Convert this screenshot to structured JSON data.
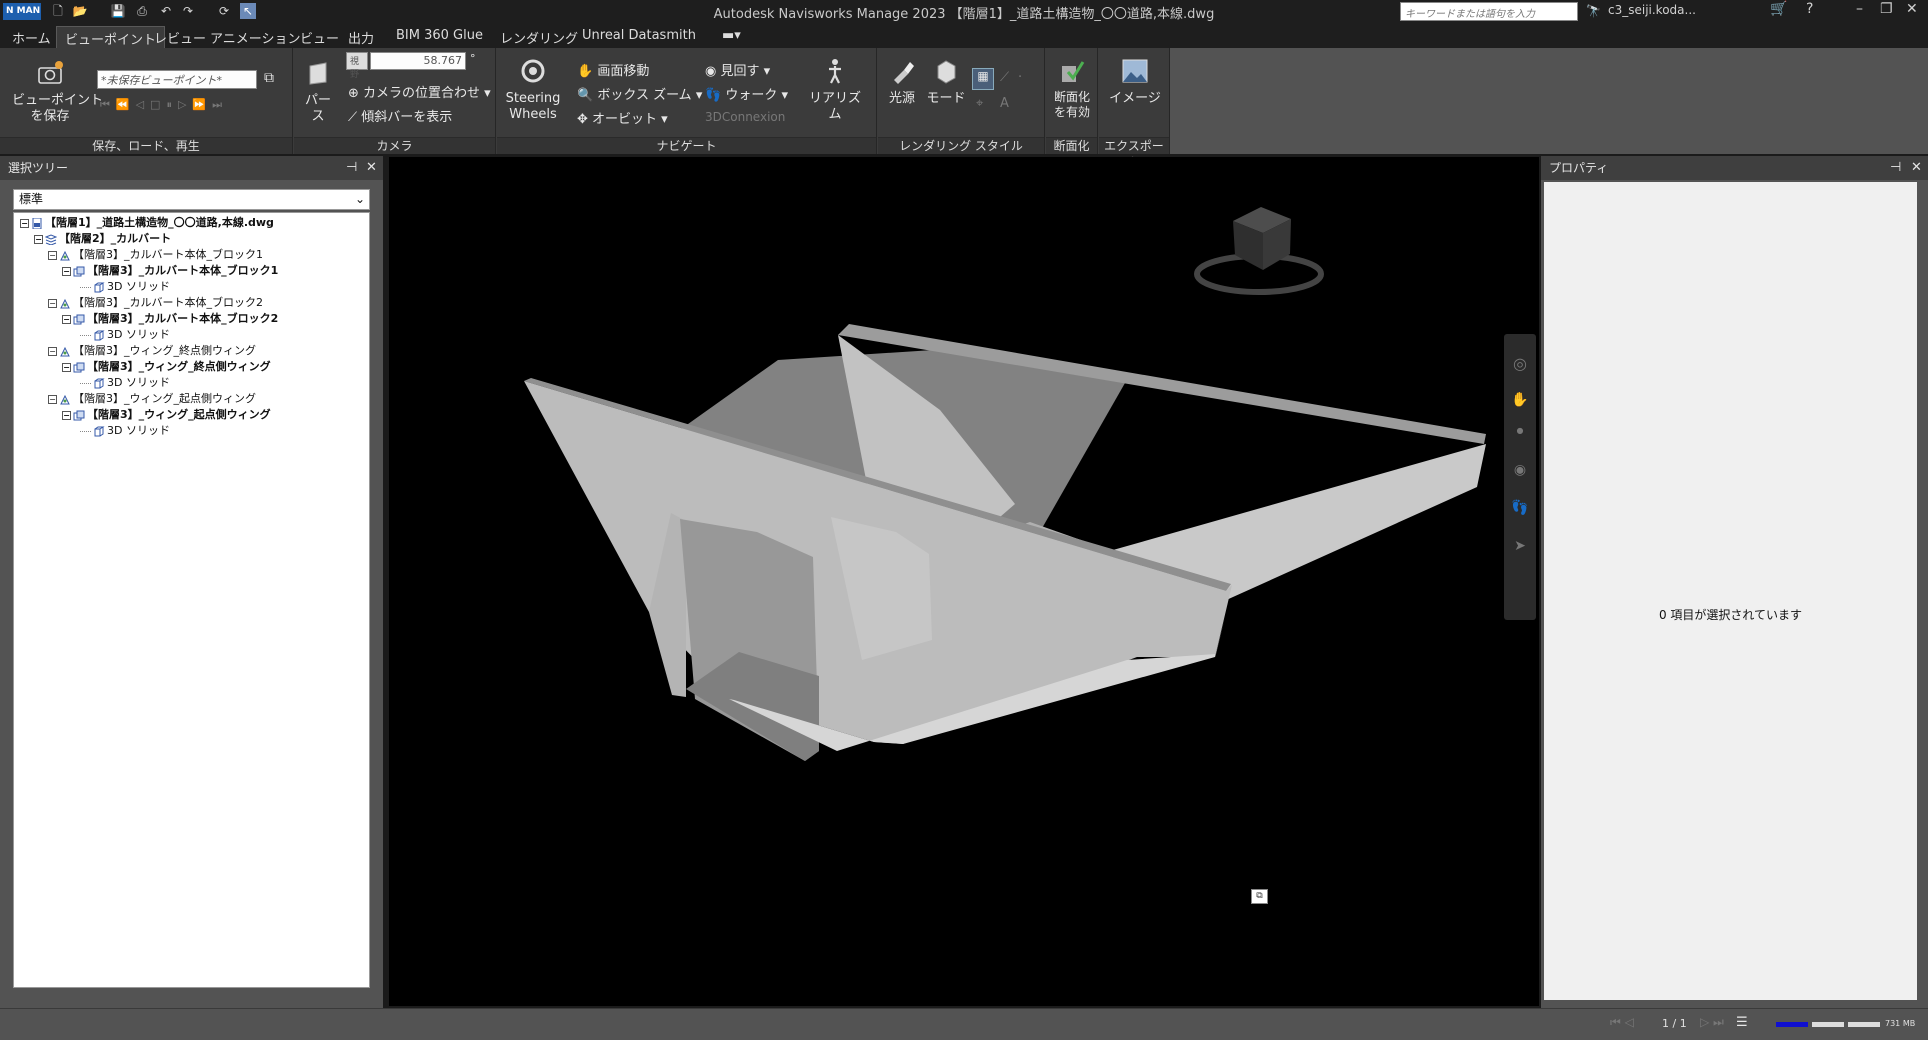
{
  "app": {
    "logo": "N MAN",
    "title": "Autodesk Navisworks Manage 2023 【階層1】_道路土構造物_〇〇道路,本線.dwg"
  },
  "titlebar": {
    "search_placeholder": "キーワードまたは語句を入力",
    "user": "c3_seiji.koda..."
  },
  "tabs": [
    "ホーム",
    "ビューポイント",
    "レビュー",
    "アニメーション",
    "ビュー",
    "出力",
    "BIM 360 Glue",
    "レンダリング",
    "Unreal Datasmith"
  ],
  "active_tab": "ビューポイント",
  "ribbon": {
    "save": {
      "button": "ビューポイント\nを保存",
      "viewpoint_placeholder": "*未保存ビューポイント*",
      "panel_title": "保存、ロード、再生"
    },
    "camera": {
      "perspective": "パース",
      "fov_label": "視野",
      "fov_value": "58.767",
      "fov_unit": "°",
      "align": "カメラの位置合わせ",
      "tilt": "傾斜バーを表示",
      "panel_title": "カメラ"
    },
    "navigate": {
      "steering": "Steering\nWheels",
      "pan": "画面移動",
      "box_zoom": "ボックス ズーム",
      "orbit": "オービット",
      "look": "見回す",
      "walk": "ウォーク",
      "connexion": "3DConnexion",
      "realism": "リアリズム",
      "panel_title": "ナビゲート"
    },
    "render_style": {
      "light": "光源",
      "mode": "モード",
      "panel_title": "レンダリング スタイル"
    },
    "sectioning": {
      "enable": "断面化\nを有効",
      "panel_title": "断面化"
    },
    "export": {
      "image": "イメージ",
      "panel_title": "エクスポート"
    }
  },
  "selection_tree": {
    "title": "選択ツリー",
    "mode": "標準",
    "nodes": [
      {
        "label": "【階層1】_道路土構造物_〇〇道路,本線.dwg",
        "bold": true,
        "level": 0,
        "expand": "−",
        "icon": "file"
      },
      {
        "label": "【階層2】_カルバート",
        "bold": true,
        "level": 1,
        "expand": "−",
        "icon": "layer"
      },
      {
        "label": "【階層3】_カルバート本体_ブロック1",
        "bold": false,
        "level": 2,
        "expand": "−",
        "icon": "block"
      },
      {
        "label": "【階層3】_カルバート本体_ブロック1",
        "bold": true,
        "level": 3,
        "expand": "−",
        "icon": "group"
      },
      {
        "label": "3D ソリッド",
        "bold": false,
        "level": 4,
        "expand": "",
        "icon": "solid"
      },
      {
        "label": "【階層3】_カルバート本体_ブロック2",
        "bold": false,
        "level": 2,
        "expand": "−",
        "icon": "block"
      },
      {
        "label": "【階層3】_カルバート本体_ブロック2",
        "bold": true,
        "level": 3,
        "expand": "−",
        "icon": "group"
      },
      {
        "label": "3D ソリッド",
        "bold": false,
        "level": 4,
        "expand": "",
        "icon": "solid"
      },
      {
        "label": "【階層3】_ウィング_終点側ウィング",
        "bold": false,
        "level": 2,
        "expand": "−",
        "icon": "block"
      },
      {
        "label": "【階層3】_ウィング_終点側ウィング",
        "bold": true,
        "level": 3,
        "expand": "−",
        "icon": "group"
      },
      {
        "label": "3D ソリッド",
        "bold": false,
        "level": 4,
        "expand": "",
        "icon": "solid"
      },
      {
        "label": "【階層3】_ウィング_起点側ウィング",
        "bold": false,
        "level": 2,
        "expand": "−",
        "icon": "block"
      },
      {
        "label": "【階層3】_ウィング_起点側ウィング",
        "bold": true,
        "level": 3,
        "expand": "−",
        "icon": "group"
      },
      {
        "label": "3D ソリッド",
        "bold": false,
        "level": 4,
        "expand": "",
        "icon": "solid"
      }
    ]
  },
  "properties": {
    "title": "プロパティ",
    "empty_message": "0 項目が選択されています"
  },
  "status": {
    "page": "1 / 1",
    "memory": "731 MB"
  }
}
